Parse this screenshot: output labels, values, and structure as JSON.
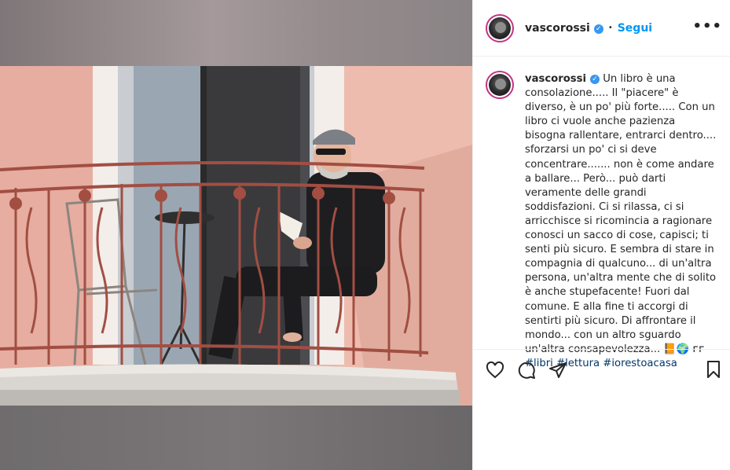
{
  "post": {
    "username": "vascorossi",
    "verified_glyph": "✓",
    "separator": "•",
    "follow_label": "Segui",
    "more_label": "•••"
  },
  "caption": {
    "username": "vascorossi",
    "text": "Un libro è una consolazione..... Il \"piacere\" è diverso, è un po' più forte..... Con un libro ci vuole anche pazienza bisogna rallentare, entrarci dentro.... sforzarsi un po' ci si deve concentrare....... non è come andare a ballare... Però... può darti veramente delle grandi soddisfazioni. Ci si rilassa, ci si arricchisce si ricomincia a ragionare conosci un sacco di cose, capisci; ti senti più sicuro. E sembra di stare in compagnia di qualcuno... di un'altra persona, un'altra mente che di solito è anche stupefacente! Fuori dal comune. E alla fine ti accorgi di sentirti più sicuro. Di affrontare il mondo... con un altro sguardo un'altra consapevolezza...",
    "emoji": "📙🌍",
    "signature": "ᴦᴦ",
    "hashtags": [
      "#libri",
      "#lettura",
      "#iorestoacasa"
    ]
  },
  "icons": {
    "like": "heart-icon",
    "comment": "comment-icon",
    "share": "paper-plane-icon",
    "save": "bookmark-icon"
  },
  "colors": {
    "link_blue": "#0095f6",
    "verified_blue": "#3897f0",
    "hashtag": "#00376b",
    "story_ring": "#c13584"
  }
}
